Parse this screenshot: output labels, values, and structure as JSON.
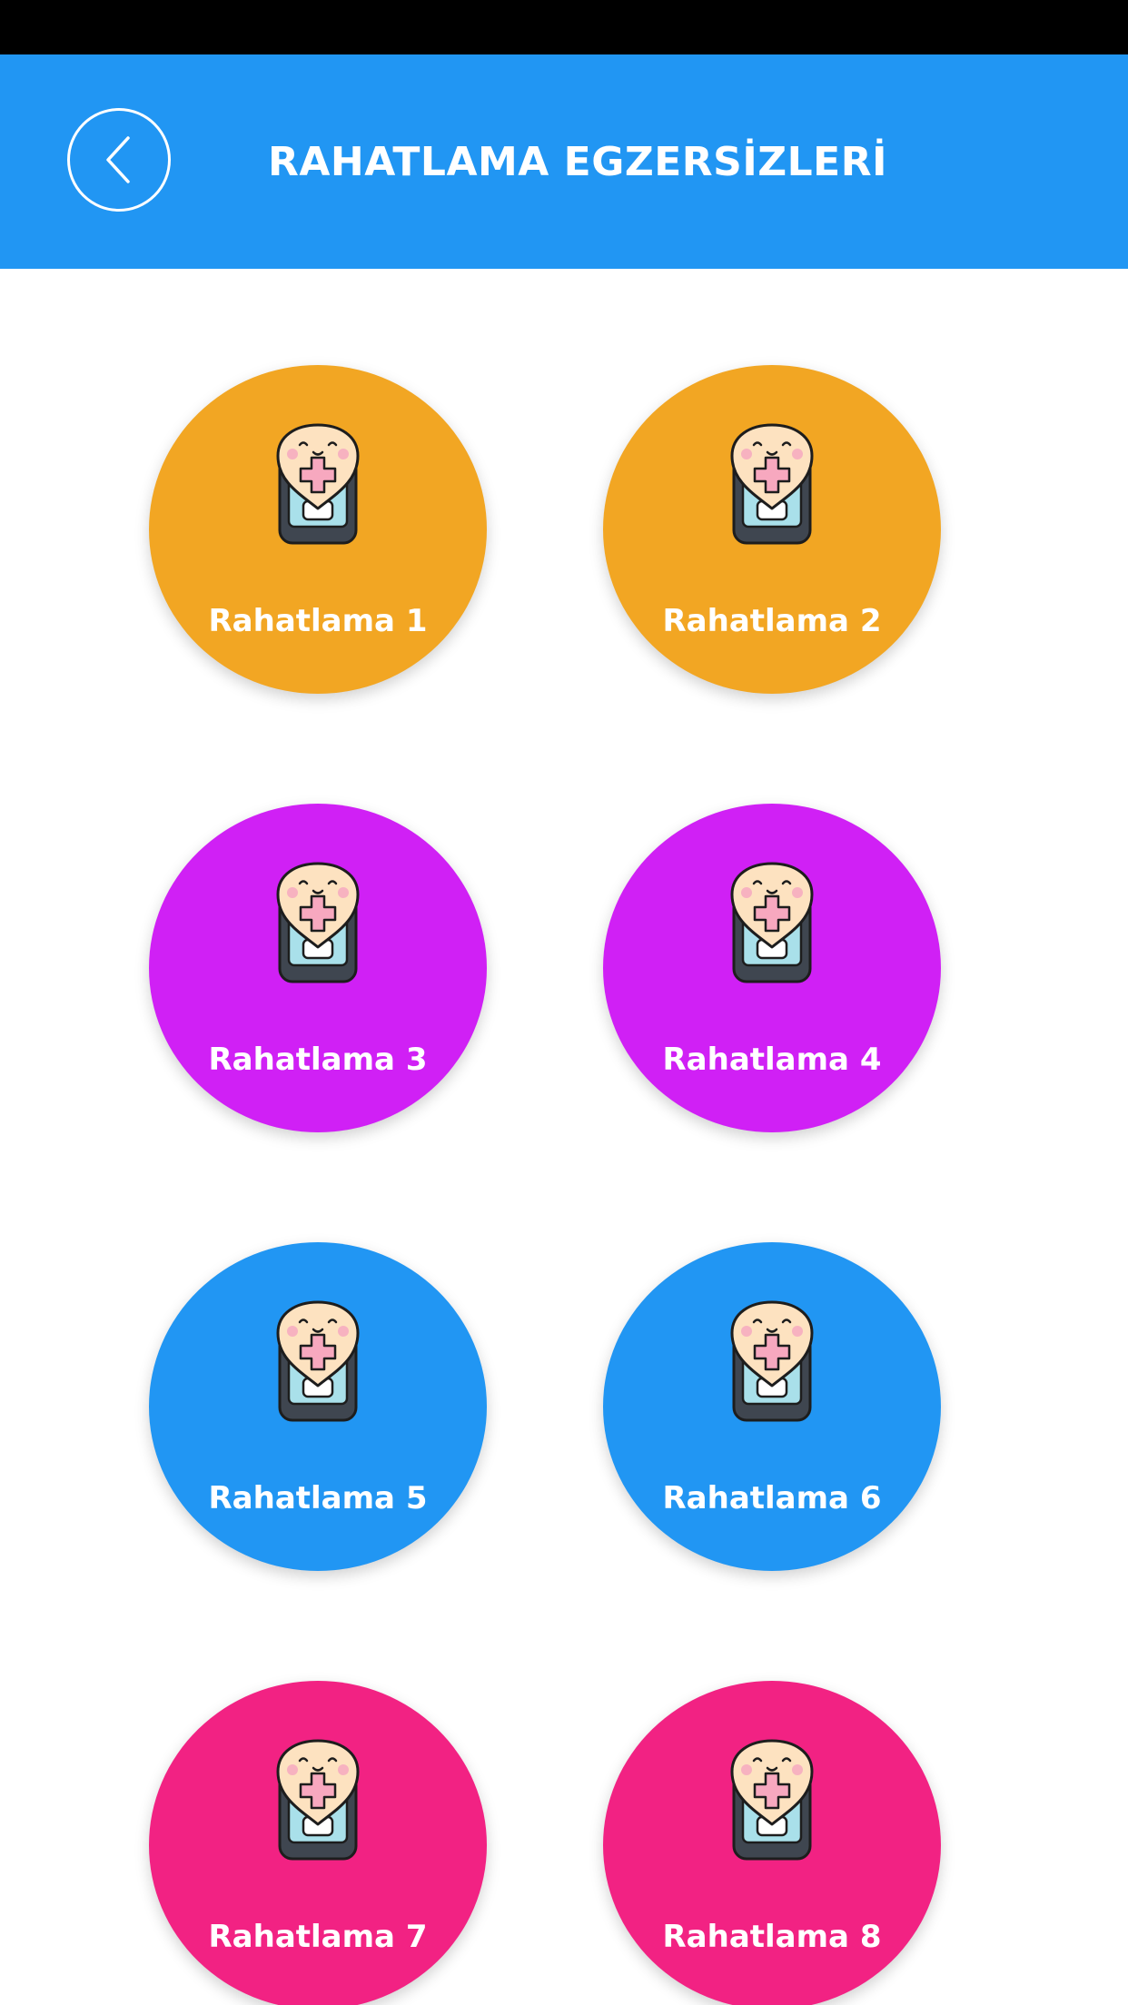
{
  "header": {
    "title": "RAHATLAMA EGZERSİZLERİ",
    "back_icon": "chevron-left-icon",
    "background": "#2196F3"
  },
  "tiles": [
    {
      "label": "Rahatlama 1",
      "color": "#F2A623",
      "icon": "phone-health-icon"
    },
    {
      "label": "Rahatlama 2",
      "color": "#F2A623",
      "icon": "phone-health-icon"
    },
    {
      "label": "Rahatlama 3",
      "color": "#D020F5",
      "icon": "phone-health-icon"
    },
    {
      "label": "Rahatlama 4",
      "color": "#D020F5",
      "icon": "phone-health-icon"
    },
    {
      "label": "Rahatlama 5",
      "color": "#2196F3",
      "icon": "phone-health-icon"
    },
    {
      "label": "Rahatlama 6",
      "color": "#2196F3",
      "icon": "phone-health-icon"
    },
    {
      "label": "Rahatlama 7",
      "color": "#F22283",
      "icon": "phone-health-icon"
    },
    {
      "label": "Rahatlama 8",
      "color": "#F22283",
      "icon": "phone-health-icon"
    }
  ]
}
